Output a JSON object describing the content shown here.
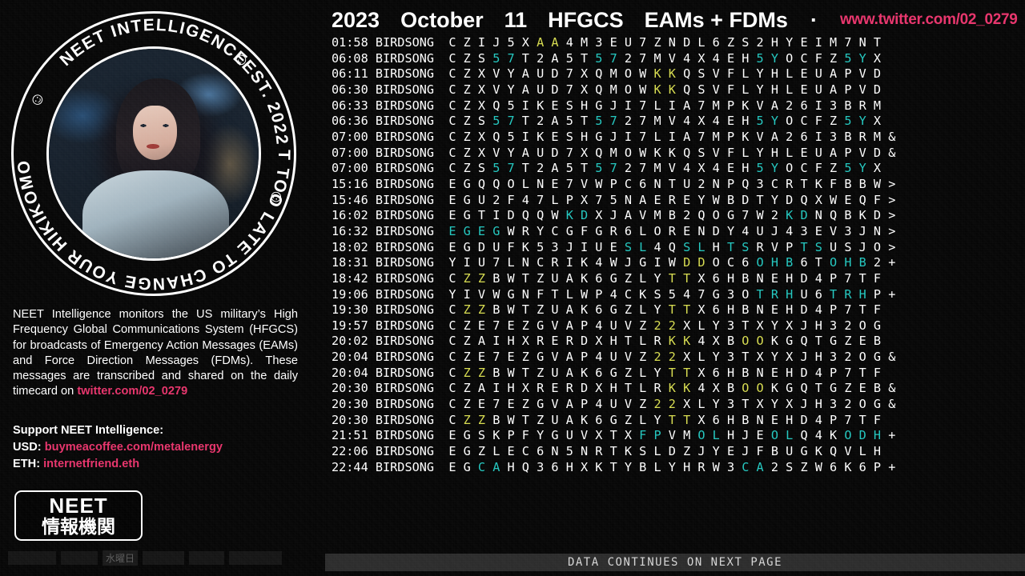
{
  "header": {
    "year": "2023",
    "month": "October",
    "day": "11",
    "system": "HFGCS",
    "message_types": "EAMs + FDMs",
    "separator": "·",
    "url": "www.twitter.com/02_0279",
    "url_color": "#e8336b"
  },
  "badge": {
    "top_text": "NEET INTELLIGENCE",
    "bottom_text": "IT'S NOT TOO LATE TO CHANGE YOUR HIKIKOMORI WAYS",
    "est_text": "EST. 2022",
    "smiley": "☺"
  },
  "description": {
    "line": "NEET Intelligence monitors the US military’s High Frequency Global Communications System (HFGCS) for broadcasts of Emergency Action Messages (EAMs) and Force Direction Messages (FDMs). These messages are transcribed and shared on the daily timecard on ",
    "twitter_handle": "twitter.com/02_0279"
  },
  "support": {
    "title": "Support NEET Intelligence:",
    "usd_label": "USD:",
    "usd_value": "buymeacoffee.com/metalenergy",
    "eth_label": "ETH:",
    "eth_value": "internetfriend.eth"
  },
  "logo_box": {
    "english": "NEET",
    "japanese": "情報機関"
  },
  "left_strip": {
    "day_label": "水曜日"
  },
  "footer": {
    "text": "DATA CONTINUES ON NEXT PAGE"
  },
  "colors": {
    "accent_pink": "#e8336b",
    "highlight_cyan": "#22c8c0",
    "highlight_yellow": "#d8dd4f",
    "text_white": "#ffffff",
    "background": "#000000"
  },
  "log": {
    "station": "BIRDSONG",
    "rows": [
      {
        "time": "01:58",
        "station": "BIRDSONG",
        "chars": "C Z I J 5 X A A 4 M 3 E U 7 Z N D L 6 Z S 2 H Y E I M 7 N T",
        "hl": {
          "6": "y",
          "7": "y"
        },
        "suffix": ""
      },
      {
        "time": "06:08",
        "station": "BIRDSONG",
        "chars": "C Z S 5 7 T 2 A 5 T 5 7 2 7 M V 4 X 4 E H 5 Y O C F Z 5 Y X",
        "hl": {
          "3": "c",
          "4": "c",
          "10": "c",
          "11": "c",
          "21": "c",
          "22": "c",
          "27": "c",
          "28": "c"
        },
        "suffix": ""
      },
      {
        "time": "06:11",
        "station": "BIRDSONG",
        "chars": "C Z X V Y A U D 7 X Q M O W K K Q S V F L Y H L E U A P V D",
        "hl": {
          "14": "y",
          "15": "y"
        },
        "suffix": ""
      },
      {
        "time": "06:30",
        "station": "BIRDSONG",
        "chars": "C Z X V Y A U D 7 X Q M O W K K Q S V F L Y H L E U A P V D",
        "hl": {
          "14": "y",
          "15": "y"
        },
        "suffix": ""
      },
      {
        "time": "06:33",
        "station": "BIRDSONG",
        "chars": "C Z X Q 5 I K E S H G J I 7 L I A 7 M P K V A 2 6 I 3 B R M",
        "hl": {},
        "suffix": ""
      },
      {
        "time": "06:36",
        "station": "BIRDSONG",
        "chars": "C Z S 5 7 T 2 A 5 T 5 7 2 7 M V 4 X 4 E H 5 Y O C F Z 5 Y X",
        "hl": {
          "3": "c",
          "4": "c",
          "10": "c",
          "11": "c",
          "21": "c",
          "22": "c",
          "27": "c",
          "28": "c"
        },
        "suffix": ""
      },
      {
        "time": "07:00",
        "station": "BIRDSONG",
        "chars": "C Z X Q 5 I K E S H G J I 7 L I A 7 M P K V A 2 6 I 3 B R M",
        "hl": {},
        "suffix": "&"
      },
      {
        "time": "07:00",
        "station": "BIRDSONG",
        "chars": "C Z X V Y A U D 7 X Q M O W K K Q S V F L Y H L E U A P V D",
        "hl": {},
        "suffix": "&"
      },
      {
        "time": "07:00",
        "station": "BIRDSONG",
        "chars": "C Z S 5 7 T 2 A 5 T 5 7 2 7 M V 4 X 4 E H 5 Y O C F Z 5 Y X",
        "hl": {
          "3": "c",
          "4": "c",
          "10": "c",
          "11": "c",
          "21": "c",
          "22": "c",
          "27": "c",
          "28": "c"
        },
        "suffix": ""
      },
      {
        "time": "15:16",
        "station": "BIRDSONG",
        "chars": "E G Q Q O L N E 7 V W P C 6 N T U 2 N P Q 3 C R T K F B B W",
        "hl": {},
        "suffix": ">"
      },
      {
        "time": "15:46",
        "station": "BIRDSONG",
        "chars": "E G U 2 F 4 7 L P X 7 5 N A E R E Y W B D T Y D Q X W E Q F",
        "hl": {},
        "suffix": ">"
      },
      {
        "time": "16:02",
        "station": "BIRDSONG",
        "chars": "E G T I D Q Q W K D X J A V M B 2 Q O G 7 W 2 K D N Q B K D",
        "hl": {
          "8": "c",
          "9": "c",
          "23": "c",
          "24": "c"
        },
        "suffix": ">"
      },
      {
        "time": "16:32",
        "station": "BIRDSONG",
        "chars": "E G E G W R Y C G F G R 6 L O R E N D Y 4 U J 4 3 E V 3 J N",
        "hl": {
          "0": "c",
          "1": "c",
          "2": "c",
          "3": "c"
        },
        "suffix": ">"
      },
      {
        "time": "18:02",
        "station": "BIRDSONG",
        "chars": "E G D U F K 5 3 J I U E S L 4 Q S L H T S R V P T S U S J O",
        "hl": {
          "12": "c",
          "13": "c",
          "16": "c",
          "17": "c",
          "19": "c",
          "20": "c",
          "24": "c",
          "25": "c"
        },
        "suffix": ">"
      },
      {
        "time": "18:31",
        "station": "BIRDSONG",
        "chars": "Y I U 7 L N C R I K 4 W J G I W D D O C 6 O H B 6 T O H B 2",
        "hl": {
          "16": "y",
          "17": "y",
          "21": "c",
          "22": "c",
          "23": "c",
          "26": "c",
          "27": "c",
          "28": "c"
        },
        "suffix": "+"
      },
      {
        "time": "18:42",
        "station": "BIRDSONG",
        "chars": "C Z Z B W T Z U A K 6 G Z L Y T T X 6 H B N E H D 4 P 7 T F",
        "hl": {
          "1": "y",
          "2": "y",
          "15": "y",
          "16": "y"
        },
        "suffix": ""
      },
      {
        "time": "19:06",
        "station": "BIRDSONG",
        "chars": "Y I V W G N F T L W P 4 C K S 5 4 7 G 3 O T R H U 6 T R H P",
        "hl": {
          "21": "c",
          "22": "c",
          "23": "c",
          "26": "c",
          "27": "c",
          "28": "c"
        },
        "suffix": "+"
      },
      {
        "time": "19:30",
        "station": "BIRDSONG",
        "chars": "C Z Z B W T Z U A K 6 G Z L Y T T X 6 H B N E H D 4 P 7 T F",
        "hl": {
          "1": "y",
          "2": "y",
          "15": "y",
          "16": "y"
        },
        "suffix": ""
      },
      {
        "time": "19:57",
        "station": "BIRDSONG",
        "chars": "C Z E 7 E Z G V A P 4 U V Z 2 2 X L Y 3 T X Y X J H 3 2 O G",
        "hl": {
          "14": "y",
          "15": "y"
        },
        "suffix": ""
      },
      {
        "time": "20:02",
        "station": "BIRDSONG",
        "chars": "C Z A I H X R E R D X H T L R K K 4 X B O O K G Q T G Z E B",
        "hl": {
          "15": "y",
          "16": "y",
          "20": "y",
          "21": "y"
        },
        "suffix": ""
      },
      {
        "time": "20:04",
        "station": "BIRDSONG",
        "chars": "C Z E 7 E Z G V A P 4 U V Z 2 2 X L Y 3 T X Y X J H 3 2 O G",
        "hl": {
          "14": "y",
          "15": "y"
        },
        "suffix": "&"
      },
      {
        "time": "20:04",
        "station": "BIRDSONG",
        "chars": "C Z Z B W T Z U A K 6 G Z L Y T T X 6 H B N E H D 4 P 7 T F",
        "hl": {
          "1": "y",
          "2": "y",
          "15": "y",
          "16": "y"
        },
        "suffix": ""
      },
      {
        "time": "20:30",
        "station": "BIRDSONG",
        "chars": "C Z A I H X R E R D X H T L R K K 4 X B O O K G Q T G Z E B",
        "hl": {
          "15": "y",
          "16": "y",
          "20": "y",
          "21": "y"
        },
        "suffix": "&"
      },
      {
        "time": "20:30",
        "station": "BIRDSONG",
        "chars": "C Z E 7 E Z G V A P 4 U V Z 2 2 X L Y 3 T X Y X J H 3 2 O G",
        "hl": {
          "14": "y",
          "15": "y"
        },
        "suffix": "&"
      },
      {
        "time": "20:30",
        "station": "BIRDSONG",
        "chars": "C Z Z B W T Z U A K 6 G Z L Y T T X 6 H B N E H D 4 P 7 T F",
        "hl": {
          "1": "y",
          "2": "y",
          "15": "y",
          "16": "y"
        },
        "suffix": ""
      },
      {
        "time": "21:51",
        "station": "BIRDSONG",
        "chars": "E G S K P F Y G U V X T X F P V M O L H J E O L Q 4 K O D H",
        "hl": {
          "13": "c",
          "14": "c",
          "17": "c",
          "18": "c",
          "22": "c",
          "23": "c",
          "27": "c",
          "28": "c",
          "29": "c"
        },
        "suffix": "+"
      },
      {
        "time": "22:06",
        "station": "BIRDSONG",
        "chars": "E G Z L E C 6 N 5 N R T K S L D Z J Y E J F B U G K Q V L H",
        "hl": {},
        "suffix": ""
      },
      {
        "time": "22:44",
        "station": "BIRDSONG",
        "chars": "E G C A H Q 3 6 H X K T Y B L Y H R W 3 C A 2 S Z W 6 K 6 P",
        "hl": {
          "2": "c",
          "3": "c",
          "20": "c",
          "21": "c"
        },
        "suffix": "+"
      }
    ]
  }
}
